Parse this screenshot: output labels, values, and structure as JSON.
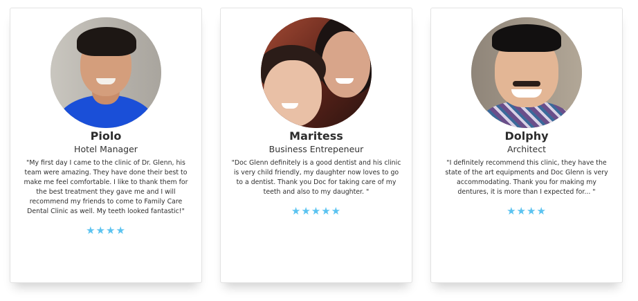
{
  "testimonials": [
    {
      "name": "Piolo",
      "role": "Hotel Manager",
      "quote": "\"My first day I came to the clinic of Dr. Glenn, his team were amazing. They have done their best to make me feel comfortable. I like to thank them for the best treatment they gave me and I will recommend my friends to come to Family Care Dental Clinic as well. My teeth looked fantastic!\"",
      "rating": 4,
      "star_glyph": "★"
    },
    {
      "name": "Maritess",
      "role": "Business Entrepeneur",
      "quote": "\"Doc Glenn definitely is a good dentist and his clinic is very child friendly, my daughter now loves to go to a dentist. Thank you Doc for taking care of my teeth and also to my daughter. \"",
      "rating": 5,
      "star_glyph": "★"
    },
    {
      "name": "Dolphy",
      "role": "Architect",
      "quote": "\"I definitely recommend this clinic, they have the state of the art equipments and Doc Glenn is very accommodating. Thank you for making my dentures, it is more than I expected for... \"",
      "rating": 4,
      "star_glyph": "★"
    }
  ],
  "colors": {
    "star": "#5bc3f0",
    "card_border": "#e2e2e2"
  }
}
